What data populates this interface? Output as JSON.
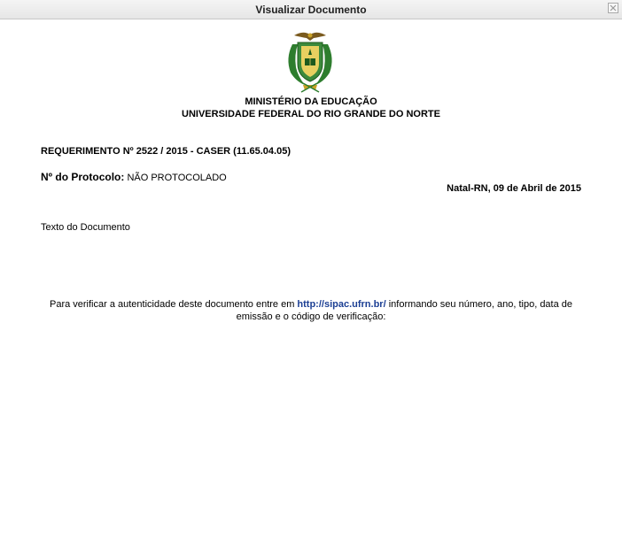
{
  "window": {
    "title": "Visualizar Documento"
  },
  "header": {
    "org_line1": "MINISTÉRIO DA EDUCAÇÃO",
    "org_line2": "UNIVERSIDADE FEDERAL DO RIO GRANDE DO NORTE",
    "crest_icon": "university-crest-icon"
  },
  "document": {
    "requerimento": "REQUERIMENTO Nº 2522 / 2015 - CASER (11.65.04.05)",
    "protocol_label": "Nº do Protocolo:",
    "protocol_value": "NÃO PROTOCOLADO",
    "date": "Natal-RN, 09 de Abril de 2015",
    "body_text": "Texto do Documento"
  },
  "footer": {
    "verify_prefix": "Para verificar a autenticidade deste documento entre em ",
    "verify_link": "http://sipac.ufrn.br/",
    "verify_suffix": " informando seu número, ano, tipo, data de emissão e o código de verificação:"
  },
  "colors": {
    "link": "#1c3f94",
    "crest_green": "#2e7d2e",
    "crest_gold": "#c9a227"
  }
}
